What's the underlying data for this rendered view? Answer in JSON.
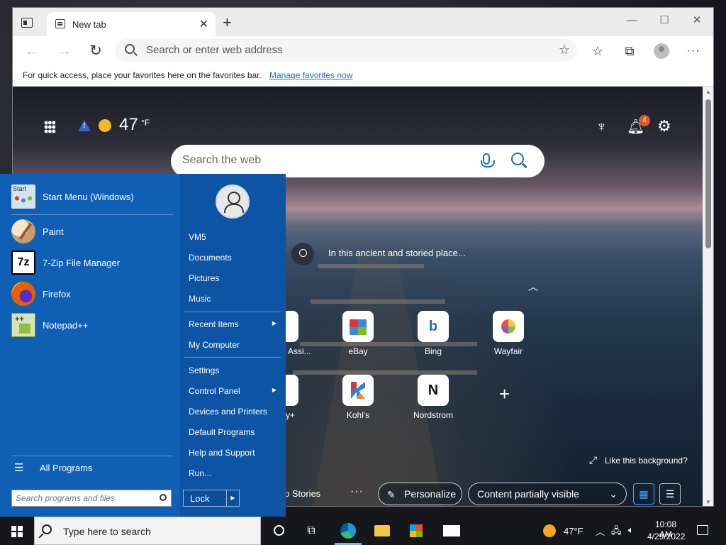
{
  "browser": {
    "tab_title": "New tab",
    "tab_close": "✕",
    "new_tab": "+",
    "address_placeholder": "Search or enter web address",
    "favbar_text": "For quick access, place your favorites here on the favorites bar.",
    "favbar_link": "Manage favorites now",
    "win_min": "—",
    "win_max": "☐",
    "win_close": "✕"
  },
  "ntp": {
    "temperature": "47",
    "temp_unit": "°F",
    "notification_count": "4",
    "search_placeholder": "Search the web",
    "caption": "In this ancient and storied place...",
    "tiles": [
      {
        "label": "eBay"
      },
      {
        "label": "Bing"
      },
      {
        "label": "Wayfair"
      },
      {
        "label": "Kohl's"
      },
      {
        "label": "Nordstrom"
      }
    ],
    "partial_tile_1": "Assi...",
    "partial_tile_2": "y+",
    "like_background": "Like this background?",
    "top_stories": "p Stories",
    "more": "···",
    "personalize": "Personalize",
    "content_visibility": "Content partially visible"
  },
  "start_menu": {
    "pinned": [
      {
        "label": "Start Menu (Windows)"
      },
      {
        "label": "Paint"
      },
      {
        "label": "7-Zip File Manager"
      },
      {
        "label": "Firefox"
      },
      {
        "label": "Notepad++"
      }
    ],
    "start_icon_text": "Start",
    "all_programs": "All Programs",
    "search_placeholder": "Search programs and files",
    "right_items": [
      {
        "label": "VM5"
      },
      {
        "label": "Documents"
      },
      {
        "label": "Pictures"
      },
      {
        "label": "Music"
      },
      {
        "label": "Recent Items"
      },
      {
        "label": "My Computer"
      },
      {
        "label": "Settings"
      },
      {
        "label": "Control Panel"
      },
      {
        "label": "Devices and Printers"
      },
      {
        "label": "Default Programs"
      },
      {
        "label": "Help and Support"
      },
      {
        "label": "Run..."
      }
    ],
    "lock": "Lock"
  },
  "taskbar": {
    "search_text": "Type here to search",
    "weather_temp": "47°F",
    "time": "10:08 AM",
    "date": "4/29/2022"
  },
  "colors": {
    "start_menu_bg": "#0d54a5",
    "accent": "#1a6fc4",
    "notification_badge": "#e05a1f"
  }
}
